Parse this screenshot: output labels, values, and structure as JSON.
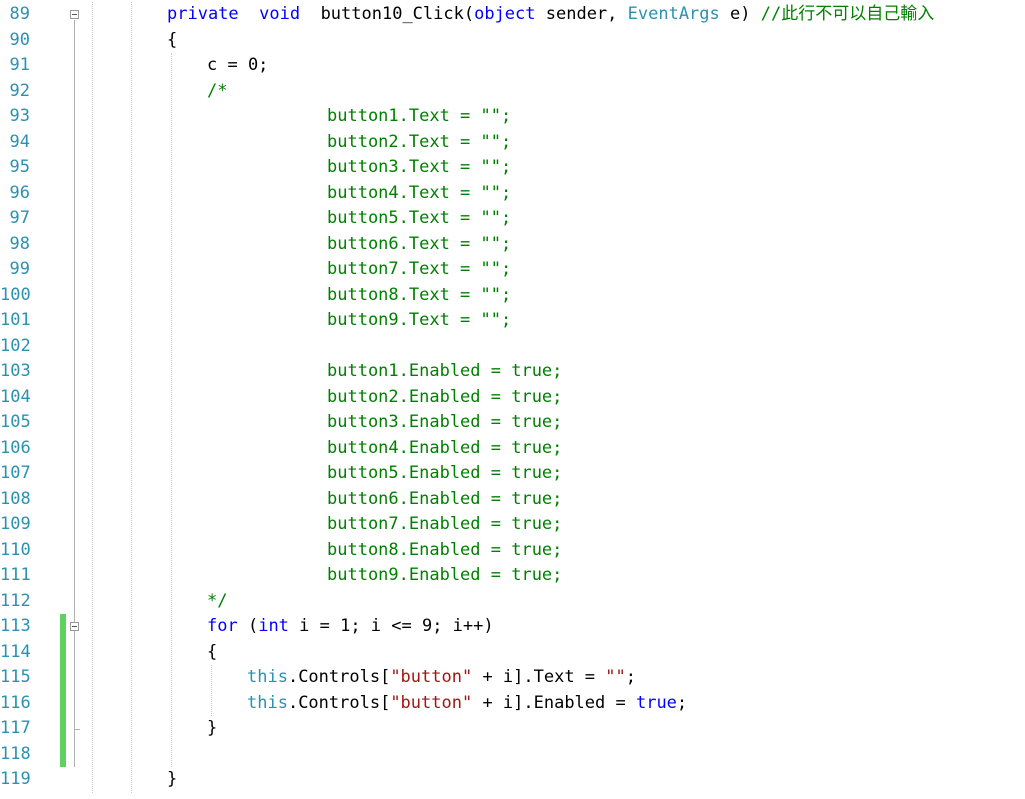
{
  "editor": {
    "lines": [
      {
        "num": "89",
        "indent": 0,
        "tokens": [
          [
            "kw",
            "private"
          ],
          [
            "",
            "  "
          ],
          [
            "kw",
            "void"
          ],
          [
            "",
            "  button10_Click("
          ],
          [
            "kw",
            "object"
          ],
          [
            "",
            " sender, "
          ],
          [
            "ty",
            "EventArgs"
          ],
          [
            "",
            " e) "
          ],
          [
            "cm",
            "//此行不可以自己輸入"
          ]
        ]
      },
      {
        "num": "90",
        "indent": 0,
        "tokens": [
          [
            "",
            "{"
          ]
        ]
      },
      {
        "num": "91",
        "indent": 1,
        "tokens": [
          [
            "",
            "c = 0;"
          ]
        ]
      },
      {
        "num": "92",
        "indent": 1,
        "tokens": [
          [
            "cm",
            "/*"
          ]
        ]
      },
      {
        "num": "93",
        "indent": 4,
        "tokens": [
          [
            "cm",
            "button1.Text = \"\";"
          ]
        ]
      },
      {
        "num": "94",
        "indent": 4,
        "tokens": [
          [
            "cm",
            "button2.Text = \"\";"
          ]
        ]
      },
      {
        "num": "95",
        "indent": 4,
        "tokens": [
          [
            "cm",
            "button3.Text = \"\";"
          ]
        ]
      },
      {
        "num": "96",
        "indent": 4,
        "tokens": [
          [
            "cm",
            "button4.Text = \"\";"
          ]
        ]
      },
      {
        "num": "97",
        "indent": 4,
        "tokens": [
          [
            "cm",
            "button5.Text = \"\";"
          ]
        ]
      },
      {
        "num": "98",
        "indent": 4,
        "tokens": [
          [
            "cm",
            "button6.Text = \"\";"
          ]
        ]
      },
      {
        "num": "99",
        "indent": 4,
        "tokens": [
          [
            "cm",
            "button7.Text = \"\";"
          ]
        ]
      },
      {
        "num": "100",
        "indent": 4,
        "tokens": [
          [
            "cm",
            "button8.Text = \"\";"
          ]
        ]
      },
      {
        "num": "101",
        "indent": 4,
        "tokens": [
          [
            "cm",
            "button9.Text = \"\";"
          ]
        ]
      },
      {
        "num": "102",
        "indent": 0,
        "tokens": []
      },
      {
        "num": "103",
        "indent": 4,
        "tokens": [
          [
            "cm",
            "button1.Enabled = true;"
          ]
        ]
      },
      {
        "num": "104",
        "indent": 4,
        "tokens": [
          [
            "cm",
            "button2.Enabled = true;"
          ]
        ]
      },
      {
        "num": "105",
        "indent": 4,
        "tokens": [
          [
            "cm",
            "button3.Enabled = true;"
          ]
        ]
      },
      {
        "num": "106",
        "indent": 4,
        "tokens": [
          [
            "cm",
            "button4.Enabled = true;"
          ]
        ]
      },
      {
        "num": "107",
        "indent": 4,
        "tokens": [
          [
            "cm",
            "button5.Enabled = true;"
          ]
        ]
      },
      {
        "num": "108",
        "indent": 4,
        "tokens": [
          [
            "cm",
            "button6.Enabled = true;"
          ]
        ]
      },
      {
        "num": "109",
        "indent": 4,
        "tokens": [
          [
            "cm",
            "button7.Enabled = true;"
          ]
        ]
      },
      {
        "num": "110",
        "indent": 4,
        "tokens": [
          [
            "cm",
            "button8.Enabled = true;"
          ]
        ]
      },
      {
        "num": "111",
        "indent": 4,
        "tokens": [
          [
            "cm",
            "button9.Enabled = true;"
          ]
        ]
      },
      {
        "num": "112",
        "indent": 1,
        "tokens": [
          [
            "cm",
            "*/"
          ]
        ]
      },
      {
        "num": "113",
        "indent": 1,
        "tokens": [
          [
            "kw",
            "for"
          ],
          [
            "",
            " ("
          ],
          [
            "kw",
            "int"
          ],
          [
            "",
            " i = 1; i <= 9; i++)"
          ]
        ]
      },
      {
        "num": "114",
        "indent": 1,
        "tokens": [
          [
            "",
            "{"
          ]
        ]
      },
      {
        "num": "115",
        "indent": 2,
        "tokens": [
          [
            "ty",
            "this"
          ],
          [
            "",
            ".Controls["
          ],
          [
            "str",
            "\"button\""
          ],
          [
            "",
            " + i].Text = "
          ],
          [
            "str",
            "\"\""
          ],
          [
            "",
            ";"
          ]
        ]
      },
      {
        "num": "116",
        "indent": 2,
        "tokens": [
          [
            "ty",
            "this"
          ],
          [
            "",
            ".Controls["
          ],
          [
            "str",
            "\"button\""
          ],
          [
            "",
            " + i].Enabled = "
          ],
          [
            "kw",
            "true"
          ],
          [
            "",
            ";"
          ]
        ]
      },
      {
        "num": "117",
        "indent": 1,
        "tokens": [
          [
            "",
            "}"
          ]
        ]
      },
      {
        "num": "118",
        "indent": 0,
        "tokens": []
      },
      {
        "num": "119",
        "indent": 0,
        "tokens": [
          [
            "",
            "}"
          ]
        ]
      }
    ],
    "colors": {
      "keyword": "#0000ff",
      "type": "#2b91af",
      "string": "#a31515",
      "comment": "#008000",
      "line_number": "#2b91af",
      "change_bar": "#5ed15e"
    }
  }
}
